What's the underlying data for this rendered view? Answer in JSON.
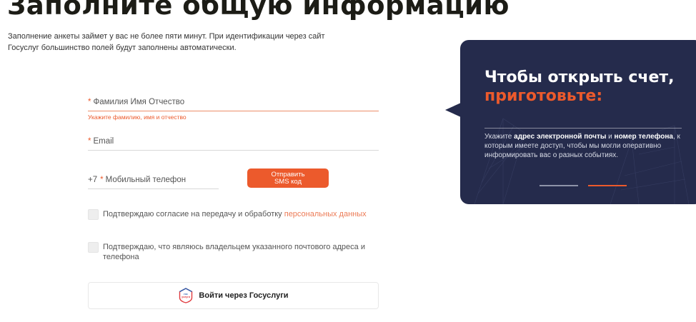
{
  "form": {
    "title": "Заполните общую информацию",
    "intro": "Заполнение анкеты займет у вас не более пяти минут. При идентификации через сайт Госуслуг большинство полей будут заполнены автоматически.",
    "required_mark": "*",
    "full_name": {
      "label": "Фамилия Имя Отчество",
      "error": "Укажите фамилию, имя и отчество"
    },
    "email": {
      "label": "Email"
    },
    "phone": {
      "prefix": "+7",
      "label": "Мобильный телефон"
    },
    "sms_button": {
      "line1": "Отправить",
      "line2": "SMS код"
    },
    "consent_personal_data": {
      "text": "Подтверждаю согласие на передачу и обработку ",
      "link": "персональных данных",
      "checked": false
    },
    "confirm_owner": {
      "text": "Подтверждаю, что являюсь владельцем указанного почтового адреса и телефона",
      "checked": false
    },
    "gosuslugi_button": {
      "label": "Войти через Госуслуги",
      "logo_line1": "гос",
      "logo_line2": "услуги"
    }
  },
  "info_card": {
    "title_line1": "Чтобы открыть счет,",
    "title_line2": "приготовьте:",
    "text_part1": "Укажите ",
    "text_bold1": "адрес электронной почты",
    "text_part2": " и ",
    "text_bold2": "номер телефона",
    "text_part3": ", к которым имеете доступ, чтобы мы могли оперативно информировать вас о разных событиях.",
    "active_slide": 2,
    "slides_total": 2
  },
  "colors": {
    "accent": "#ec5a2c",
    "card_bg": "#252b4c",
    "title": "#1c1c16"
  },
  "icons": [
    "gosuslugi-logo-icon"
  ]
}
